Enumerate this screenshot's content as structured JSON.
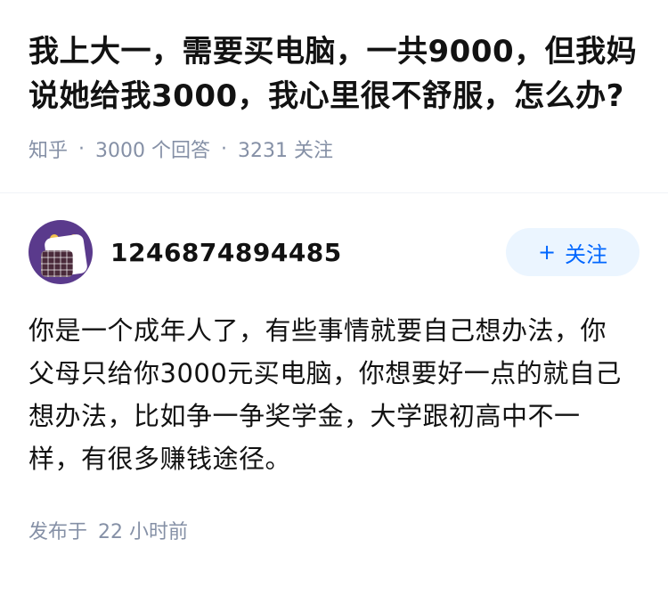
{
  "question": {
    "title": "我上大一，需要买电脑，一共9000，但我妈说她给我3000，我心里很不舒服，怎么办?",
    "source": "知乎",
    "answer_count": "3000",
    "answer_label": "个回答",
    "follower_count": "3231",
    "follower_label": "关注"
  },
  "answer": {
    "author_name": "1246874894485",
    "follow_button": {
      "icon": "plus-icon",
      "label": "关注"
    },
    "content": "你是一个成年人了，有些事情就要自己想办法，你父母只给你3000元买电脑，你想要好一点的就自己想办法，比如争一争奖学金，大学跟初高中不一样，有很多赚钱途径。",
    "published_label": "发布于",
    "published_time": "22 小时前"
  },
  "colors": {
    "title": "#121212",
    "meta": "#8590a6",
    "accent": "#0066ff",
    "follow_bg": "#ebf5ff",
    "avatar_bg": "#5a3a8c"
  }
}
